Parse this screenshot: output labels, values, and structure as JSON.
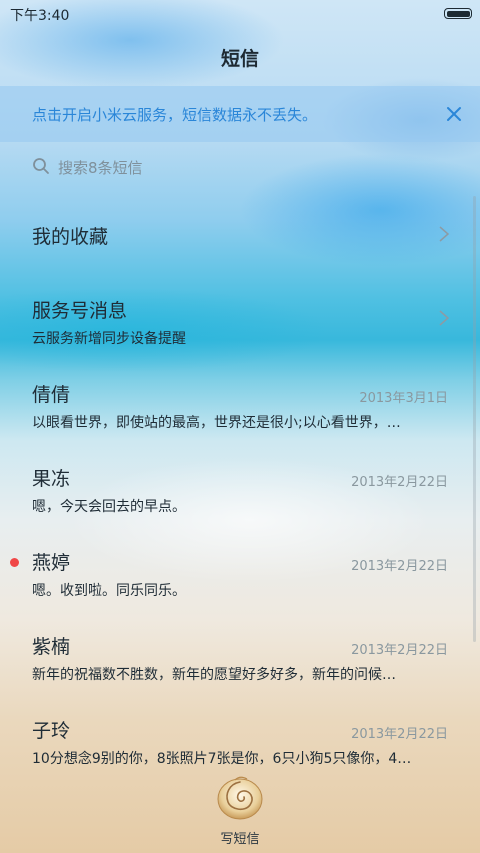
{
  "status_bar": {
    "time": "下午3:40",
    "battery_icon": "battery-full-icon",
    "battery_level": 1.0
  },
  "header": {
    "title": "短信"
  },
  "banner": {
    "text": "点击开启小米云服务，短信数据永不丢失。",
    "close_icon": "close-icon",
    "accent_color": "#2a86d8"
  },
  "search": {
    "icon": "search-icon",
    "placeholder": "搜索8条短信"
  },
  "list": {
    "items": [
      {
        "title": "我的收藏",
        "subtitle": "",
        "date": "",
        "unread": false,
        "has_chevron": true
      },
      {
        "title": "服务号消息",
        "subtitle": "云服务新增同步设备提醒",
        "date": "",
        "unread": false,
        "has_chevron": true
      },
      {
        "title": "倩倩",
        "subtitle": "以眼看世界，即使站的最高，世界还是很小;以心看世界，…",
        "date": "2013年3月1日",
        "unread": false,
        "has_chevron": false
      },
      {
        "title": "果冻",
        "subtitle": "嗯，今天会回去的早点。",
        "date": "2013年2月22日",
        "unread": false,
        "has_chevron": false
      },
      {
        "title": "燕婷",
        "subtitle": "嗯。收到啦。同乐同乐。",
        "date": "2013年2月22日",
        "unread": true,
        "has_chevron": false
      },
      {
        "title": "紫楠",
        "subtitle": "新年的祝福数不胜数，新年的愿望好多好多，新年的问候…",
        "date": "2013年2月22日",
        "unread": false,
        "has_chevron": false
      },
      {
        "title": "子玲",
        "subtitle": "10分想念9别的你，8张照片7张是你，6只小狗5只像你，4…",
        "date": "2013年2月22日",
        "unread": false,
        "has_chevron": false
      }
    ]
  },
  "compose": {
    "icon": "shell-icon",
    "label": "写短信"
  },
  "colors": {
    "unread_dot": "#f04747",
    "date_text": "#8a989f"
  }
}
